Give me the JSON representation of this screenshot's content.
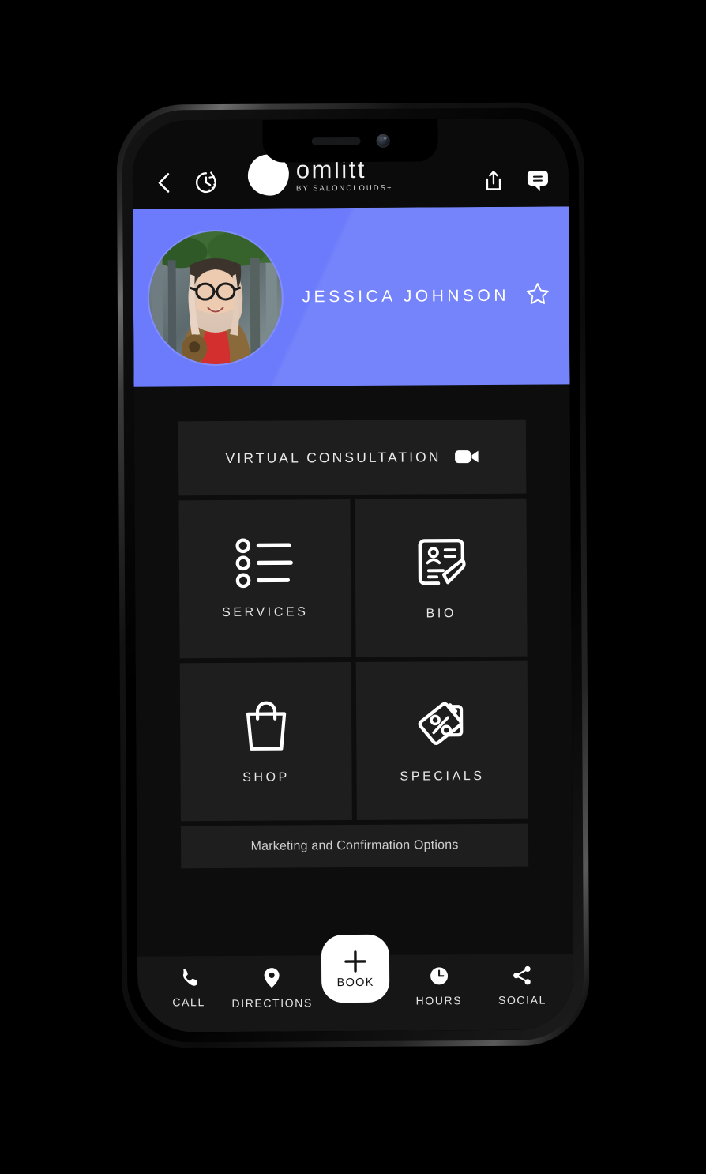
{
  "app": {
    "brand_name": "omlitt",
    "brand_tagline": "BY SALONCLOUDS+",
    "accent_color": "#6b7bfb",
    "surface_color": "#1e1e1e",
    "background_color": "#0d0d0d"
  },
  "header": {
    "back_icon": "chevron-left-icon",
    "history_icon": "clock-history-icon",
    "share_icon": "share-icon",
    "chat_icon": "chat-bubble-icon"
  },
  "profile": {
    "name": "JESSICA JOHNSON",
    "favorite_icon": "star-outline-icon",
    "avatar_icon": "avatar-photo"
  },
  "main": {
    "virtual_consultation": {
      "label": "VIRTUAL CONSULTATION",
      "icon": "video-camera-icon"
    },
    "tiles": [
      {
        "label": "SERVICES",
        "icon": "bullet-list-icon"
      },
      {
        "label": "BIO",
        "icon": "profile-card-edit-icon"
      },
      {
        "label": "SHOP",
        "icon": "shopping-bag-icon"
      },
      {
        "label": "SPECIALS",
        "icon": "discount-tags-icon"
      }
    ],
    "marketing_options": "Marketing and Confirmation Options"
  },
  "bottom_nav": {
    "items": [
      {
        "label": "CALL",
        "icon": "phone-icon"
      },
      {
        "label": "DIRECTIONS",
        "icon": "location-pin-icon"
      },
      {
        "label": "HOURS",
        "icon": "clock-icon"
      },
      {
        "label": "SOCIAL",
        "icon": "share-nodes-icon"
      }
    ],
    "book": {
      "label": "BOOK",
      "icon": "plus-icon"
    }
  }
}
